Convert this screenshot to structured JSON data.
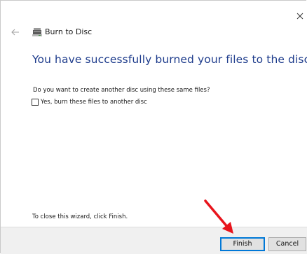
{
  "window": {
    "title": "Burn to Disc"
  },
  "icons": {
    "close": "close-icon",
    "back": "back-arrow-icon",
    "disc": "disc-burner-icon",
    "annotation_arrow": "red-arrow-annotation-icon"
  },
  "wizard": {
    "heading": "You have successfully burned your files to the disc",
    "question": "Do you want to create another disc using these same files?",
    "checkbox_label": "Yes, burn these files to another disc",
    "checkbox_checked": false,
    "close_hint": "To close this wizard, click Finish."
  },
  "buttons": {
    "finish_label": "Finish",
    "cancel_label": "Cancel"
  },
  "colors": {
    "heading": "#1e3c8c",
    "annotation_arrow": "#e8141c",
    "default_button_border": "#0078d7",
    "footer_background": "#f0f0f0"
  }
}
